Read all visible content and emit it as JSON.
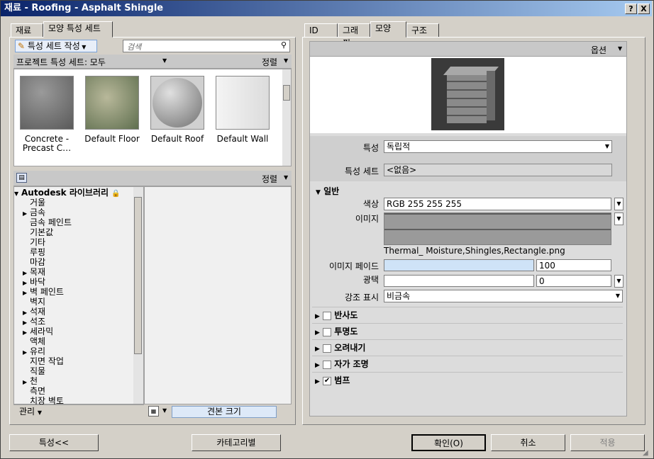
{
  "window": {
    "title": "재료 - Roofing - Asphalt Shingle",
    "help_btn": "?",
    "close_btn": "X"
  },
  "left_tabs": [
    "재료",
    "모양 특성 세트"
  ],
  "right_tabs": [
    "ID",
    "그래픽",
    "모양",
    "구조"
  ],
  "toolbar": {
    "create_set": "특성 세트 작성",
    "search_placeholder": "검색"
  },
  "project_bar": {
    "label": "프로젝트 특성 세트: 모두",
    "sort": "정렬"
  },
  "thumbnails": [
    {
      "label": "Concrete - Precast C…"
    },
    {
      "label": "Default Floor"
    },
    {
      "label": "Default Roof"
    },
    {
      "label": "Default Wall"
    }
  ],
  "library_bar": {
    "sort": "정렬"
  },
  "library": {
    "root": "Autodesk 라이브러리",
    "items": [
      {
        "label": "거울",
        "expandable": false
      },
      {
        "label": "금속",
        "expandable": true
      },
      {
        "label": "금속 페인트",
        "expandable": false
      },
      {
        "label": "기본값",
        "expandable": false
      },
      {
        "label": "기타",
        "expandable": false
      },
      {
        "label": "루핑",
        "expandable": false
      },
      {
        "label": "마감",
        "expandable": false
      },
      {
        "label": "목재",
        "expandable": true
      },
      {
        "label": "바닥",
        "expandable": true
      },
      {
        "label": "벽 페인트",
        "expandable": true
      },
      {
        "label": "벽지",
        "expandable": false
      },
      {
        "label": "석재",
        "expandable": true
      },
      {
        "label": "석조",
        "expandable": true
      },
      {
        "label": "세라믹",
        "expandable": true
      },
      {
        "label": "액체",
        "expandable": false
      },
      {
        "label": "유리",
        "expandable": true
      },
      {
        "label": "지면 작업",
        "expandable": false
      },
      {
        "label": "직물",
        "expandable": false
      },
      {
        "label": "천",
        "expandable": true
      },
      {
        "label": "측면",
        "expandable": false
      },
      {
        "label": "치장 벽토",
        "expandable": false
      }
    ]
  },
  "bottom_left": {
    "manage": "관리",
    "size_label": "견본 크기"
  },
  "right": {
    "options": "옵션",
    "props": {
      "property_label": "특성",
      "property_value": "독립적",
      "set_label": "특성 세트",
      "set_value": "<없음>"
    },
    "general": {
      "title": "일반",
      "color_label": "색상",
      "color_value": "RGB 255 255 255",
      "image_label": "이미지",
      "image_file": "Thermal_ Moisture,Shingles,Rectangle.png",
      "fade_label": "이미지 페이드",
      "fade_value": "100",
      "gloss_label": "광택",
      "gloss_value": "0",
      "highlight_label": "강조 표시",
      "highlight_value": "비금속"
    },
    "sections": [
      {
        "label": "반사도",
        "checked": false
      },
      {
        "label": "투명도",
        "checked": false
      },
      {
        "label": "오려내기",
        "checked": false
      },
      {
        "label": "자가 조명",
        "checked": false
      },
      {
        "label": "범프",
        "checked": true
      }
    ]
  },
  "buttons": {
    "properties": "특성<<",
    "by_category": "카테고리별",
    "ok": "확인(O)",
    "cancel": "취소",
    "apply": "적용"
  }
}
